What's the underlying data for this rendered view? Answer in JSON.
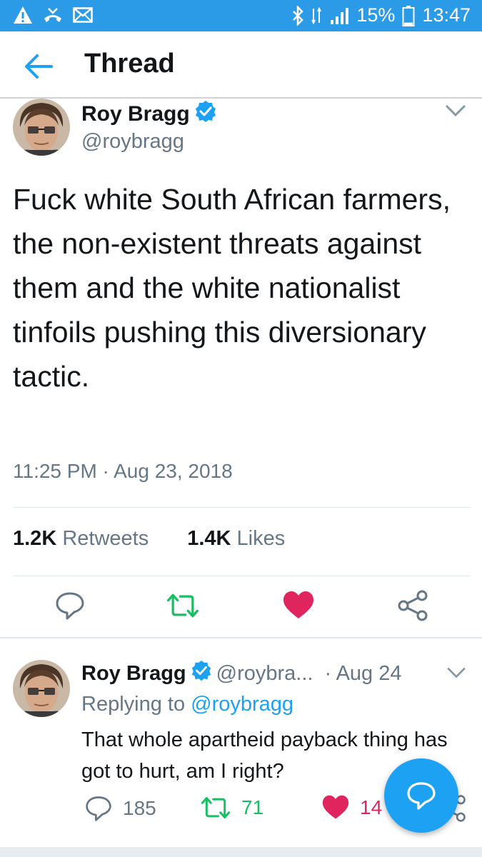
{
  "status_bar": {
    "battery": "15%",
    "time": "13:47",
    "left_icons": [
      "warning-icon",
      "missed-call-icon",
      "mail-icon"
    ],
    "right_icons": [
      "bluetooth-icon",
      "data-icon",
      "signal-icon",
      "battery-icon"
    ]
  },
  "header": {
    "title": "Thread"
  },
  "main_tweet": {
    "name": "Roy Bragg",
    "handle": "@roybragg",
    "text": "Fuck white South African farmers, the non-existent threats against them and the white nationalist tinfoils pushing this diversionary tactic.",
    "timestamp": "11:25 PM · Aug 23, 2018",
    "retweets_count": "1.2K",
    "retweets_label": "Retweets",
    "likes_count": "1.4K",
    "likes_label": "Likes"
  },
  "reply_tweet": {
    "name": "Roy Bragg",
    "handle": "@roybra...",
    "date": "· Aug 24",
    "replying_prefix": "Replying to",
    "replying_to": "@roybragg",
    "text": "That whole apartheid payback thing has got to hurt, am I right?",
    "reply_count": "185",
    "retweet_count": "71",
    "like_count": "14"
  },
  "colors": {
    "status_bar": "#2b9be8",
    "accent": "#1da1f2",
    "retweet": "#17bf63",
    "like": "#e0245e",
    "secondary_text": "#657786"
  }
}
